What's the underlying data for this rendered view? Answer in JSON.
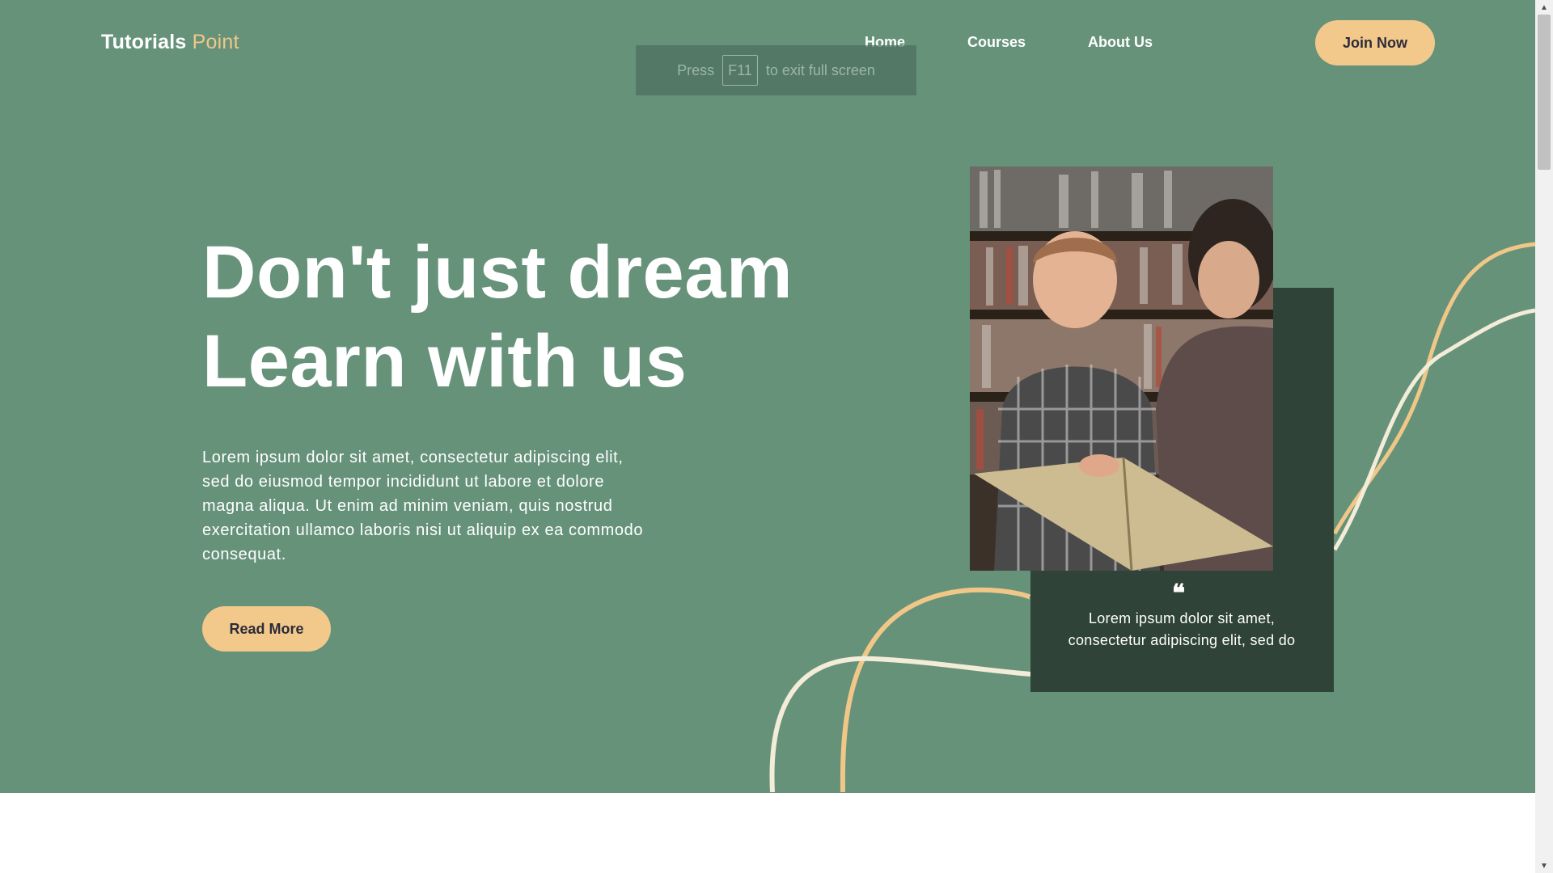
{
  "navbar": {
    "brand_main": "Tutorials",
    "brand_accent": "Point",
    "links": [
      "Home",
      "Courses",
      "About Us"
    ],
    "join_label": "Join Now"
  },
  "fullscreen_notice": {
    "prefix": "Press",
    "key": "F11",
    "suffix": "to exit full screen"
  },
  "hero": {
    "headline_line1": "Don't just dream",
    "headline_line2": "Learn with us",
    "description": "Lorem ipsum dolor sit amet, consectetur adipiscing elit, sed do eiusmod tempor incididunt ut labore et dolore magna aliqua. Ut enim ad minim veniam, quis nostrud exercitation ullamco laboris nisi ut aliquip ex ea commodo consequat.",
    "read_more_label": "Read More"
  },
  "quote_card": {
    "icon": "quote-icon",
    "text": "Lorem ipsum dolor sit amet, consectetur adipiscing elit, sed do"
  },
  "colors": {
    "hero_bg": "#66927a",
    "accent": "#f3c98b",
    "card_dark": "#2f4338",
    "text": "#ffffff"
  }
}
